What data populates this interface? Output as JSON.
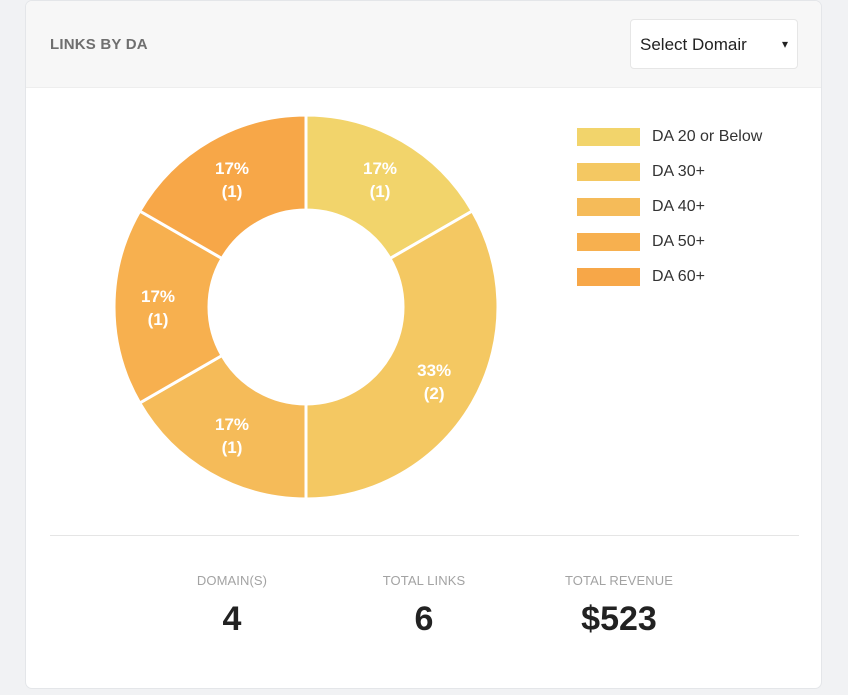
{
  "header": {
    "title": "LINKS BY DA",
    "select_label": "Select Domair",
    "select_caret": "▾"
  },
  "chart_data": {
    "type": "pie",
    "variant": "donut",
    "slices": [
      {
        "name": "DA 20 or Below",
        "value": 1,
        "percent_label": "17%",
        "count_label": "(1)",
        "color": "#f2d46b"
      },
      {
        "name": "DA 30+",
        "value": 2,
        "percent_label": "33%",
        "count_label": "(2)",
        "color": "#f4c862"
      },
      {
        "name": "DA 40+",
        "value": 1,
        "percent_label": "17%",
        "count_label": "(1)",
        "color": "#f5bb59"
      },
      {
        "name": "DA 50+",
        "value": 1,
        "percent_label": "17%",
        "count_label": "(1)",
        "color": "#f7b04f"
      },
      {
        "name": "DA 60+",
        "value": 1,
        "percent_label": "17%",
        "count_label": "(1)",
        "color": "#f7a748"
      }
    ],
    "legend_position": "top-right"
  },
  "stats": {
    "domains": {
      "label": "DOMAIN(S)",
      "value": "4"
    },
    "total_links": {
      "label": "TOTAL LINKS",
      "value": "6"
    },
    "total_revenue": {
      "label": "TOTAL REVENUE",
      "value": "$523"
    }
  }
}
